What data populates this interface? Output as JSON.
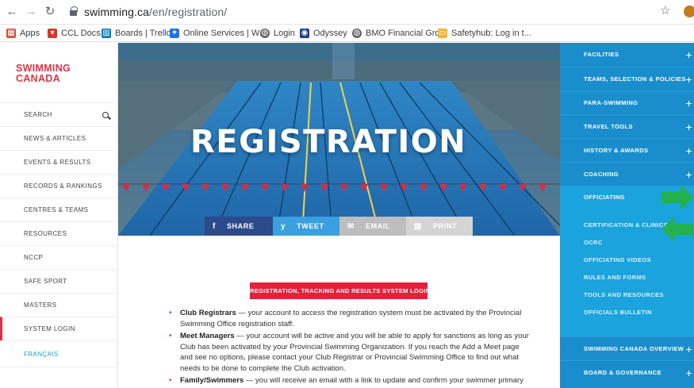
{
  "browser": {
    "url_domain": "swimming.ca",
    "url_path": "/en/registration/",
    "back_icon": "arrow-left-icon",
    "bookmarks": [
      {
        "label": "Apps",
        "color": "#d24c3b"
      },
      {
        "label": "CCL Docs",
        "color": "#d6362b"
      },
      {
        "label": "Boards | Trello",
        "color": "#0079bf"
      },
      {
        "label": "Online Services | W...",
        "color": "#1a73e8"
      },
      {
        "label": "Login",
        "color": "#5f6368"
      },
      {
        "label": "Odyssey",
        "color": "#1a3b8f"
      },
      {
        "label": "BMO Financial Gro...",
        "color": "#5f6368"
      },
      {
        "label": "Safetyhub: Log in t...",
        "color": "#f2b43a"
      }
    ]
  },
  "sidebar": {
    "logo_line1": "SWIMMING",
    "logo_line2": "CANADA",
    "items": [
      "SEARCH",
      "NEWS & ARTICLES",
      "EVENTS & RESULTS",
      "RECORDS & RANKINGS",
      "CENTRES & TEAMS",
      "RESOURCES",
      "NCCP",
      "SAFE SPORT",
      "MASTERS",
      "SYSTEM LOGIN"
    ],
    "language": "FRANÇAIS"
  },
  "hero": {
    "title": "REGISTRATION",
    "share": [
      {
        "label": "SHARE",
        "icon": "f",
        "color": "#2d4a8a"
      },
      {
        "label": "TWEET",
        "icon": "y",
        "color": "#3aa0df"
      },
      {
        "label": "EMAIL",
        "icon": "✉",
        "color": "#bdbdbd"
      },
      {
        "label": "PRINT",
        "icon": "▤",
        "color": "#d4d4d4"
      }
    ]
  },
  "content": {
    "button_label": "REGISTRATION, TRACKING AND RESULTS SYSTEM LOGIN ➜",
    "bullets": [
      {
        "bold": "Club Registrars",
        "text": " — your account to access the registration system must be activated by the Provincial Swimming Office registration staff."
      },
      {
        "bold": "Meet Managers",
        "text": " — your account will be active and you will be able to apply for sanctions as long as your Club has been activated by your Provincial Swimming Organization. If you reach the Add a Meet page and see no options, please contact your Club Registrar or Provincial Swimming Office to find out what needs to be done to complete the Club activation."
      },
      {
        "bold": "Family/Swimmers",
        "text": " — you will receive an email with a link to update and confirm your swimmer primary"
      }
    ]
  },
  "rightnav": {
    "items_top": [
      "FACILITIES",
      "TEAMS, SELECTION & POLICIES",
      "PARA-SWIMMING",
      "TRAVEL TOOLS",
      "HISTORY & AWARDS",
      "COACHING"
    ],
    "expanded": "OFFICIATING",
    "sub_links": [
      "CERTIFICATION & CLINICS",
      "OCRC",
      "OFFICIATING VIDEOS",
      "RULES AND FORMS",
      "TOOLS AND RESOURCES",
      "OFFICIALS BULLETIN"
    ],
    "items_bottom": [
      "SWIMMING CANADA OVERVIEW",
      "BOARD & GOVERNANCE"
    ]
  }
}
